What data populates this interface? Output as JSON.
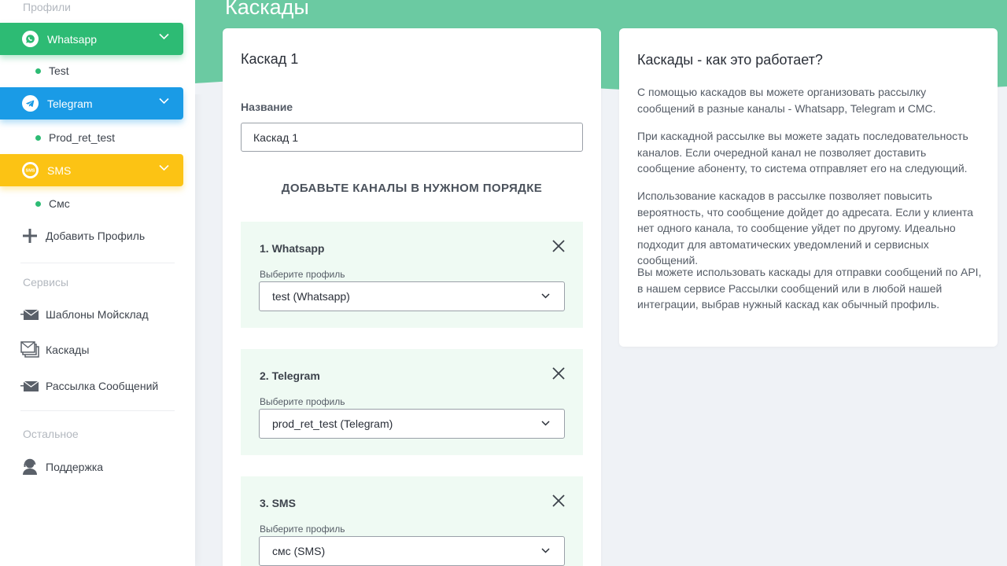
{
  "sidebar": {
    "profiles_title": "Профили",
    "profiles": [
      {
        "label": "Whatsapp",
        "color": "#2dbb74",
        "icon": "whatsapp-icon",
        "sub": "Test"
      },
      {
        "label": "Telegram",
        "color": "#1a9be6",
        "icon": "telegram-icon",
        "sub": "Prod_ret_test"
      },
      {
        "label": "SMS",
        "color": "#fcc314",
        "icon": "sms-icon",
        "sub": "Смс"
      }
    ],
    "add_profile": "Добавить Профиль",
    "services_title": "Сервисы",
    "services": [
      {
        "label": "Шаблоны Мойсклад",
        "icon": "envelope-icon"
      },
      {
        "label": "Каскады",
        "icon": "stacked-envelopes-icon"
      },
      {
        "label": "Рассылка Сообщений",
        "icon": "envelope-icon"
      }
    ],
    "other_title": "Остальное",
    "support": "Поддержка"
  },
  "main": {
    "page_title": "Каскады",
    "cascade": {
      "title": "Каскад 1",
      "name_label": "Название",
      "name_value": "Каскад 1",
      "channels_heading": "ДОБАВЬТЕ КАНАЛЫ В НУЖНОМ ПОРЯДКЕ",
      "select_label": "Выберите профиль",
      "channels": [
        {
          "name": "1. Whatsapp",
          "selected": "test (Whatsapp)"
        },
        {
          "name": "2. Telegram",
          "selected": "prod_ret_test (Telegram)"
        },
        {
          "name": "3. SMS",
          "selected": "смс (SMS)"
        }
      ]
    },
    "info": {
      "title": "Каскады - как это работает?",
      "paragraphs": [
        "С помощью каскадов вы можете организовать рассылку сообщений в разные каналы - Whatsapp, Telegram и СМС.",
        "При каскадной рассылке вы можете задать последовательность каналов. Если очередной канал не позволяет доставить сообщение абоненту, то система отправляет его на следующий.",
        "Использование каскадов в рассылке позволяет повысить вероятность, что сообщение дойдет до адресата. Если у клиента нет одного канала, то сообщение уйдет по другому. Идеально подходит для автоматических уведомлений и сервисных сообщений.",
        "Вы можете использовать каскады для отправки сообщений по API, в нашем сервисе Рассылки сообщений или в любой нашей интеграции, выбрав нужный каскад как обычный профиль."
      ]
    }
  },
  "colors": {
    "banner": "#6bcaa2",
    "channel_bg": "#effaf3",
    "status_dot": "#2dbb74"
  }
}
